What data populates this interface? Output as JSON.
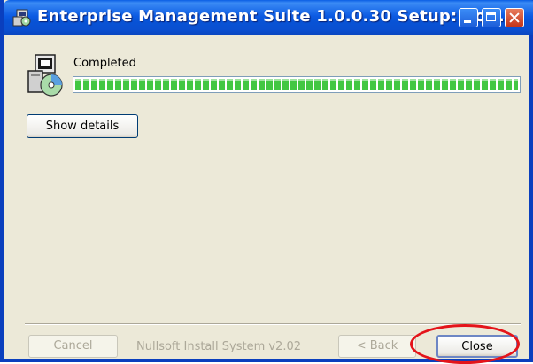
{
  "window": {
    "title": "Enterprise Management Suite 1.0.0.30 Setup: Co...",
    "controls": {
      "minimize_icon": "minimize-icon",
      "maximize_icon": "maximize-icon",
      "close_icon": "close-icon"
    }
  },
  "status": {
    "label": "Completed",
    "progress_percent": 100,
    "progress_color": "#42c742"
  },
  "buttons": {
    "show_details": "Show details",
    "cancel": "Cancel",
    "back": "< Back",
    "close": "Close"
  },
  "branding": "Nullsoft Install System v2.02",
  "annotation": {
    "highlight_color": "#e4141a"
  }
}
